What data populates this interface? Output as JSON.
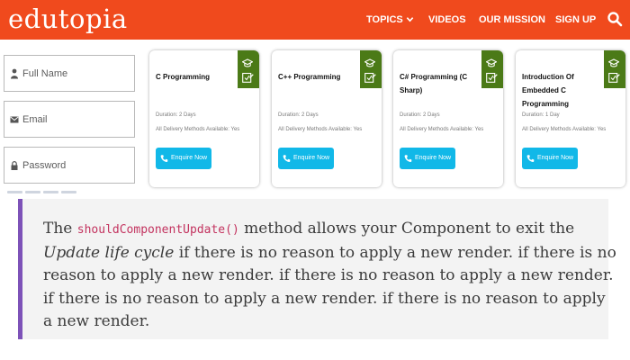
{
  "header": {
    "logo": "edutopia",
    "nav": [
      {
        "label": "TOPICS",
        "has_dropdown": true
      },
      {
        "label": "VIDEOS"
      },
      {
        "label": "OUR MISSION"
      },
      {
        "label": "SIGN UP"
      }
    ],
    "search_icon": "search-icon"
  },
  "form": {
    "full_name": {
      "placeholder": "Full Name",
      "icon": "user-icon"
    },
    "email": {
      "placeholder": "Email",
      "icon": "envelope-icon"
    },
    "password": {
      "placeholder": "Password",
      "icon": "lock-icon"
    }
  },
  "courses": [
    {
      "title": "C Programming",
      "duration": "Duration: 2 Days",
      "delivery": "All Delivery Methods Available: Yes",
      "cta": "Enquire Now"
    },
    {
      "title": "C++ Programming",
      "duration": "Duration: 2 Days",
      "delivery": "All Delivery Methods Available: Yes",
      "cta": "Enquire Now"
    },
    {
      "title": "C# Programming (C Sharp)",
      "duration": "Duration: 2 Days",
      "delivery": "All Delivery Methods Available: Yes",
      "cta": "Enquire Now"
    },
    {
      "title": "Introduction Of Embedded C Programming",
      "duration": "Duration: 1 Day",
      "delivery": "All Delivery Methods Available: Yes",
      "cta": "Enquire Now"
    }
  ],
  "quote": {
    "lead": "The ",
    "code": "shouldComponentUpdate()",
    "part2": " method allows your Component to exit the ",
    "emphasis": "Update life cycle",
    "part3": " if there is no reason to apply a new render. if there is no reason to apply a new render. if there is no reason to apply a new render. if there is no reason to apply a new render. if there is no reason to apply a new render."
  },
  "colors": {
    "brand": "#f04a1d",
    "badge": "#4b7a17",
    "enquire_button": "#11b8e8",
    "quote_border": "#7d52b8",
    "code_text": "#c3335f"
  }
}
